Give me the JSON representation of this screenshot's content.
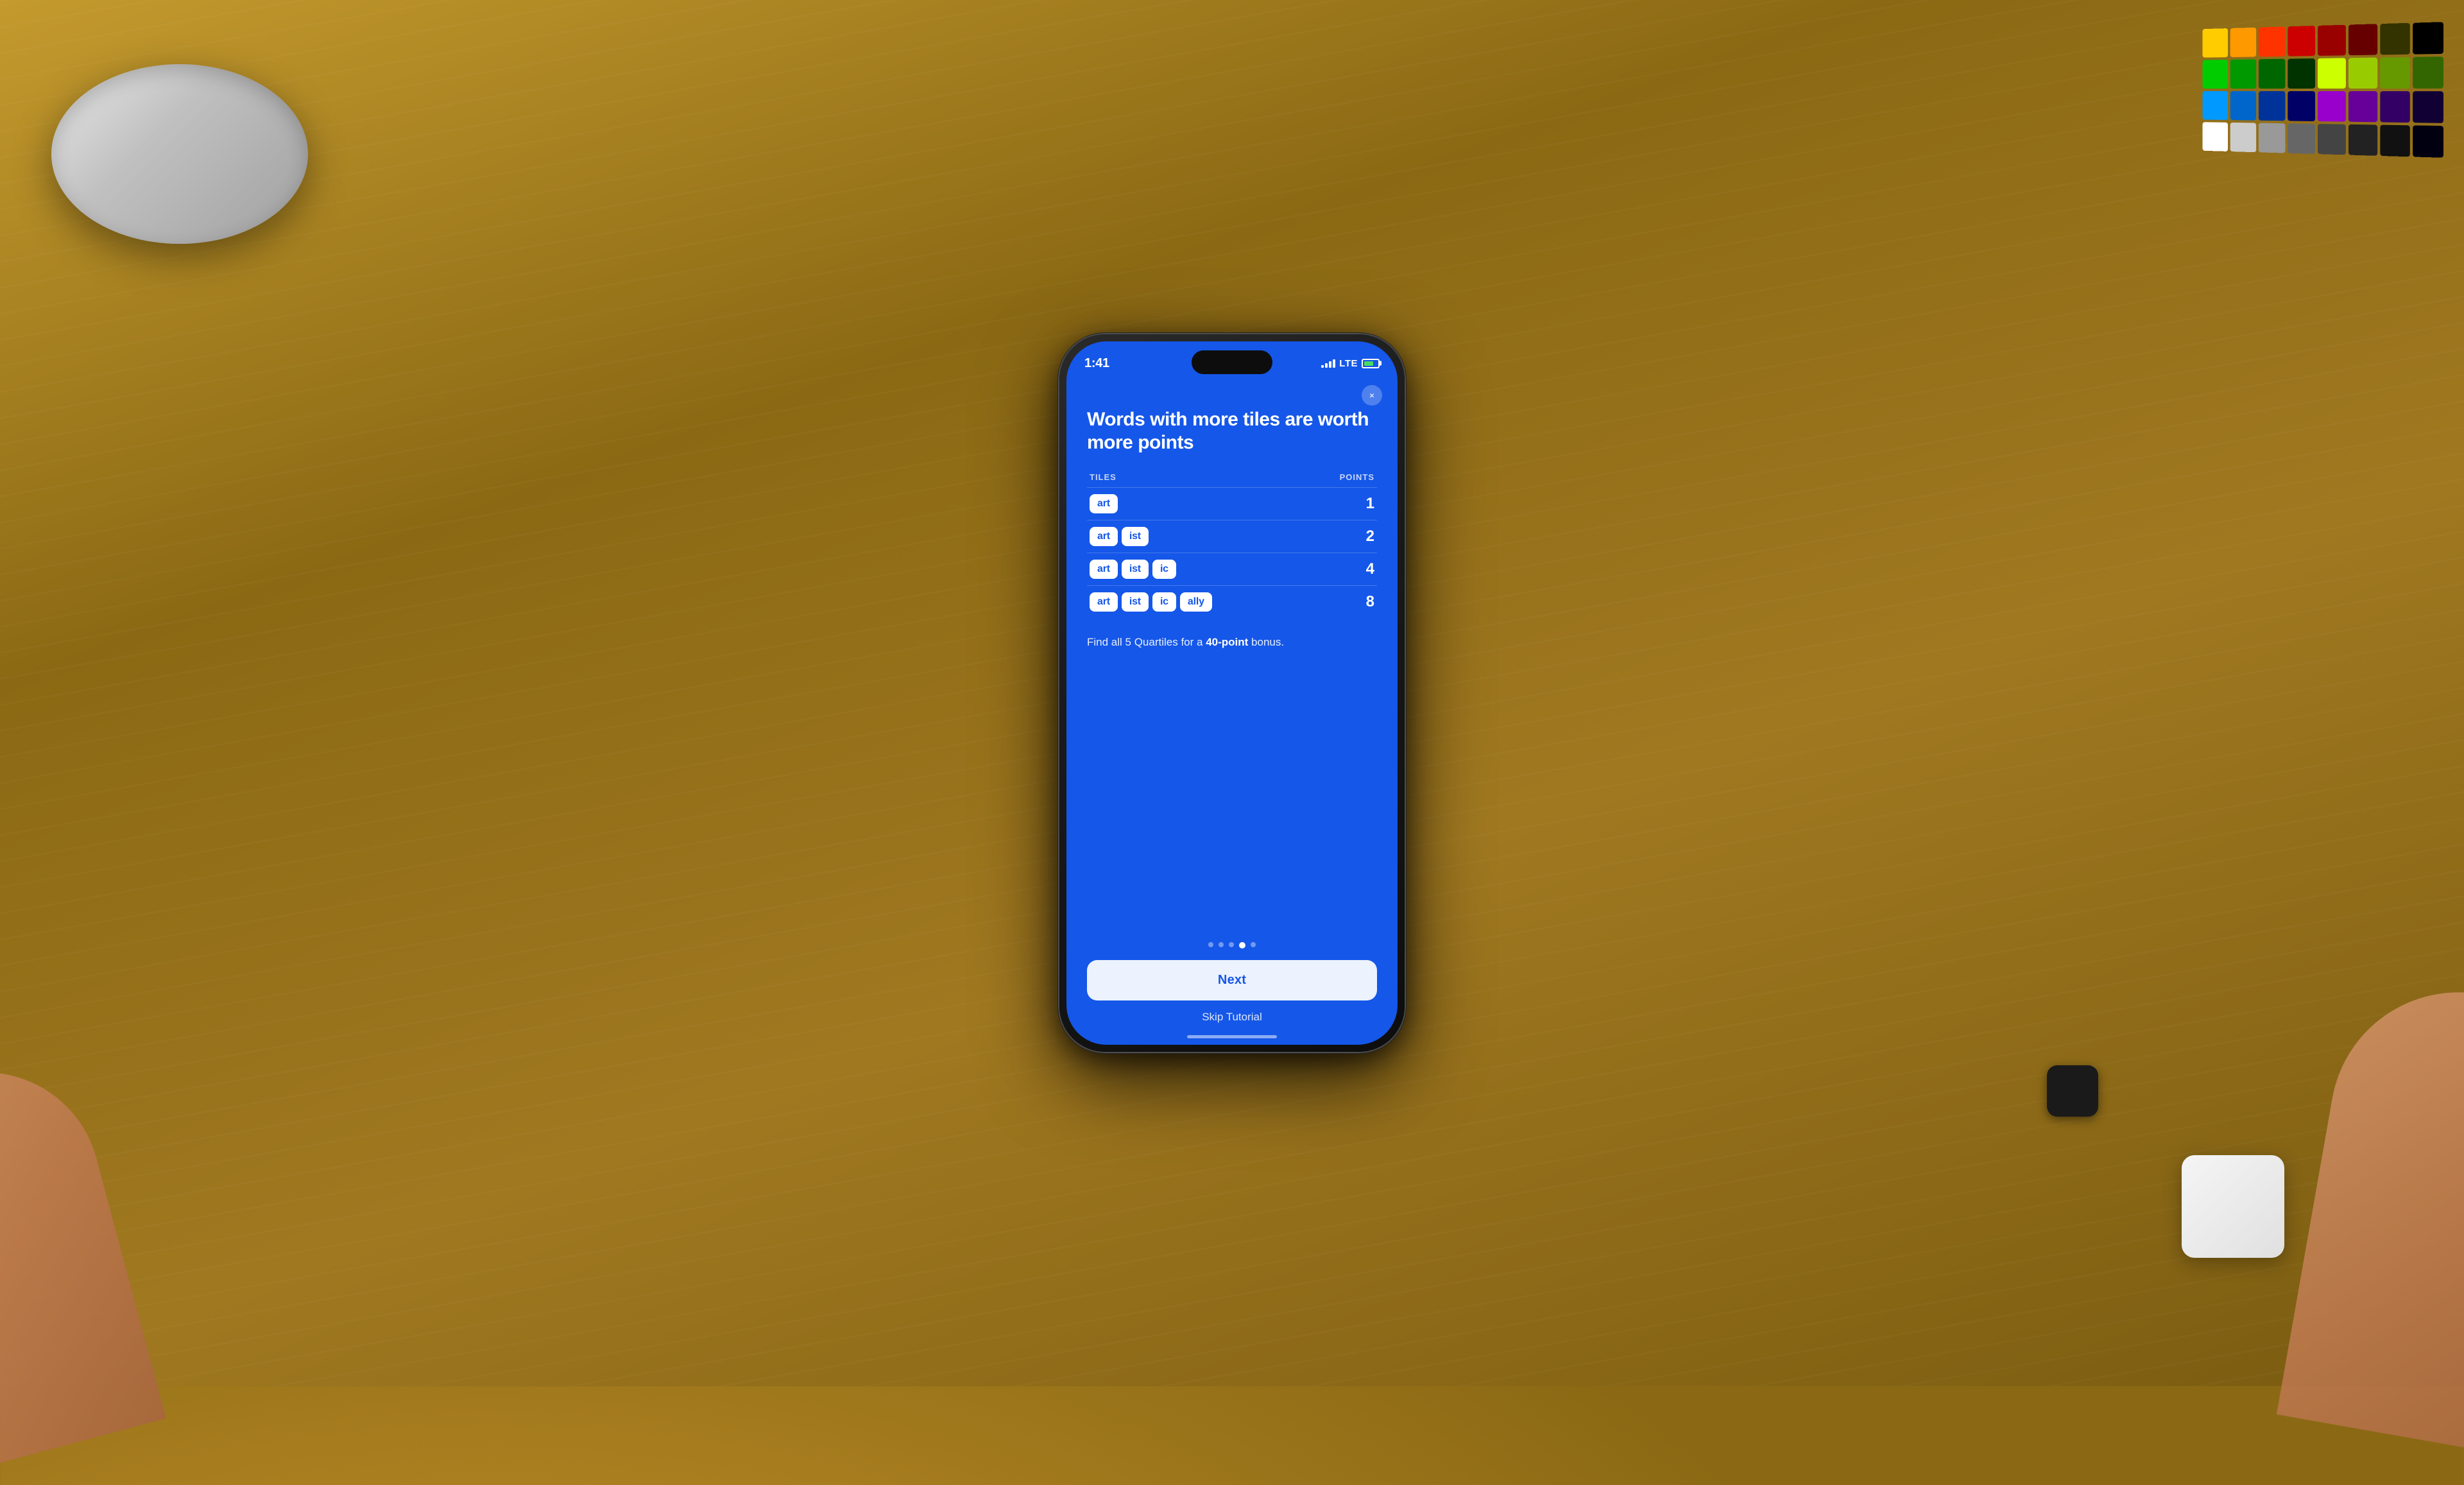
{
  "scene": {
    "background_color": "#8B6914"
  },
  "phone": {
    "status_bar": {
      "time": "1:41",
      "signal_label": "signal",
      "lte_label": "LTE",
      "battery_level": 70
    },
    "close_button_label": "×",
    "content": {
      "title": "Words with more tiles are worth more points",
      "table": {
        "tiles_column_header": "TILES",
        "points_column_header": "POINTS",
        "rows": [
          {
            "tiles": [
              "art"
            ],
            "points": "1"
          },
          {
            "tiles": [
              "art",
              "ist"
            ],
            "points": "2"
          },
          {
            "tiles": [
              "art",
              "ist",
              "ic"
            ],
            "points": "4"
          },
          {
            "tiles": [
              "art",
              "ist",
              "ic",
              "ally"
            ],
            "points": "8"
          }
        ]
      },
      "bonus_text_prefix": "Find all 5 Quartiles for a ",
      "bonus_highlight": "40-point",
      "bonus_text_suffix": " bonus.",
      "pagination": {
        "total_dots": 5,
        "active_dot": 3
      },
      "next_button_label": "Next",
      "skip_button_label": "Skip Tutorial"
    }
  },
  "colors": {
    "phone_bg": "#1557e8",
    "tile_bg": "#ffffff",
    "tile_text": "#1557e8",
    "next_btn_bg": "rgba(255,255,255,0.92)",
    "swatches": [
      "#ffcc00",
      "#ff9900",
      "#ff3300",
      "#cc0000",
      "#990000",
      "#660000",
      "#333300",
      "#000000",
      "#00cc00",
      "#009900",
      "#006600",
      "#003300",
      "#ccff00",
      "#99cc00",
      "#669900",
      "#336600",
      "#0099ff",
      "#0066cc",
      "#003399",
      "#000066",
      "#9900cc",
      "#660099",
      "#330066",
      "#110033",
      "#ffffff",
      "#cccccc",
      "#999999",
      "#666666",
      "#444444",
      "#222222",
      "#111111",
      "#000011"
    ]
  }
}
